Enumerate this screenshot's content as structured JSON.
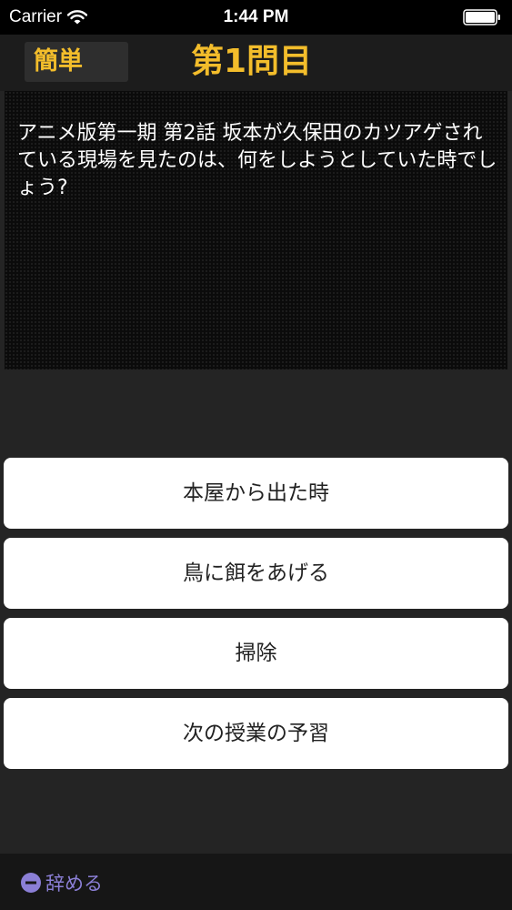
{
  "status_bar": {
    "carrier": "Carrier",
    "time": "1:44 PM"
  },
  "header": {
    "difficulty": "簡単",
    "question_number": "第1問目"
  },
  "question": {
    "text": "アニメ版第一期 第2話 坂本が久保田のカツアゲされている現場を見たのは、何をしようとしていた時でしょう?"
  },
  "answers": [
    {
      "label": "本屋から出た時"
    },
    {
      "label": "鳥に餌をあげる"
    },
    {
      "label": "掃除"
    },
    {
      "label": "次の授業の予習"
    }
  ],
  "footer": {
    "quit_label": "辞める"
  },
  "colors": {
    "accent_gold": "#f3bd2b",
    "quit_purple": "#8b7fd6"
  },
  "icons": {
    "wifi": "wifi-icon",
    "battery": "battery-icon",
    "quit": "minus-circle-icon"
  }
}
